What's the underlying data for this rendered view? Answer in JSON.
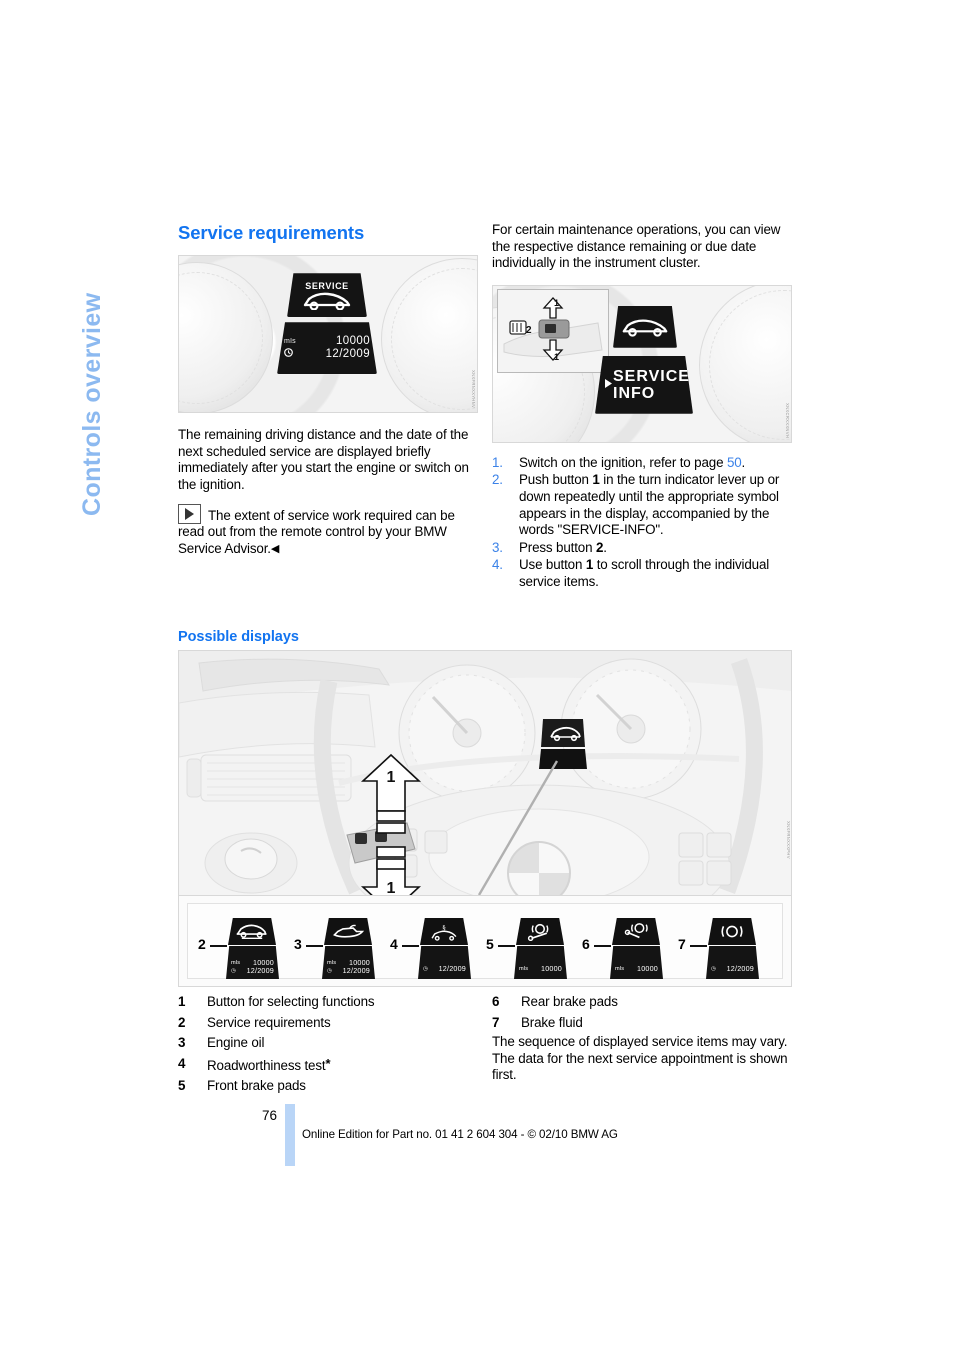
{
  "sidetab": {
    "label": "Controls overview"
  },
  "left": {
    "heading": "Service requirements",
    "figure1": {
      "name": "instrument-cluster-service-display",
      "service_label": "SERVICE",
      "unit": "mls",
      "distance": "10000",
      "date": "12/2009",
      "code": "XNXFRNXXYHNV"
    },
    "paragraph": "The remaining driving distance and the date of the next scheduled service are displayed briefly immediately after you start the engine or switch on the ignition.",
    "note": {
      "icon": "note-triangle-icon",
      "text": "The extent of service work required can be read out from the remote control by your BMW Service Advisor.",
      "endmark": "◀"
    },
    "subheading": "Possible displays"
  },
  "right": {
    "intro": "For certain maintenance operations, you can view the respective distance remaining or due date individually in the instrument cluster.",
    "figure2": {
      "name": "instrument-cluster-service-info-display",
      "inset_labels": [
        "1",
        "2"
      ],
      "display_text_line1": "SERVICE-",
      "display_text_line2": "INFO",
      "code": "XNXCRXXXNVH"
    },
    "steps": [
      {
        "num": "1.",
        "parts": [
          {
            "t": "Switch on the ignition, refer to page "
          },
          {
            "t": "50",
            "style": "link"
          },
          {
            "t": "."
          }
        ]
      },
      {
        "num": "2.",
        "parts": [
          {
            "t": "Push button "
          },
          {
            "t": "1",
            "style": "bold"
          },
          {
            "t": " in the turn indicator lever up or down repeatedly until the appropriate symbol appears in the display, accompanied by the words \"SERVICE-INFO\"."
          }
        ]
      },
      {
        "num": "3.",
        "parts": [
          {
            "t": "Press button "
          },
          {
            "t": "2",
            "style": "bold"
          },
          {
            "t": "."
          }
        ]
      },
      {
        "num": "4.",
        "parts": [
          {
            "t": "Use button "
          },
          {
            "t": "1",
            "style": "bold"
          },
          {
            "t": " to scroll through the individual service items."
          }
        ]
      }
    ]
  },
  "bigfigure": {
    "name": "steering-wheel-and-cluster-photo",
    "code": "XNXFRNXXXPHV",
    "arrow_labels": {
      "up": "1",
      "down": "1"
    },
    "icons": [
      {
        "num": "2",
        "symbol": "service-car-icon",
        "unit": "mls",
        "distance": "10000",
        "date": "12/2009"
      },
      {
        "num": "3",
        "symbol": "engine-oil-can-icon",
        "unit": "mls",
        "distance": "10000",
        "date": "12/2009"
      },
      {
        "num": "4",
        "symbol": "roadworthiness-car-icon",
        "unit": "",
        "distance": "",
        "date": "12/2009"
      },
      {
        "num": "5",
        "symbol": "front-brake-pads-icon",
        "unit": "mls",
        "distance": "10000",
        "date": ""
      },
      {
        "num": "6",
        "symbol": "rear-brake-pads-icon",
        "unit": "mls",
        "distance": "10000",
        "date": ""
      },
      {
        "num": "7",
        "symbol": "brake-fluid-icon",
        "unit": "",
        "distance": "",
        "date": "12/2009"
      }
    ]
  },
  "legend_left": [
    {
      "num": "1",
      "label": "Button for selecting functions",
      "star": ""
    },
    {
      "num": "2",
      "label": "Service requirements",
      "star": ""
    },
    {
      "num": "3",
      "label": "Engine oil",
      "star": ""
    },
    {
      "num": "4",
      "label": "Roadworthiness test",
      "star": "*"
    },
    {
      "num": "5",
      "label": "Front brake pads",
      "star": ""
    }
  ],
  "legend_right": [
    {
      "num": "6",
      "label": "Rear brake pads",
      "star": ""
    },
    {
      "num": "7",
      "label": "Brake fluid",
      "star": ""
    }
  ],
  "closing": "The sequence of displayed service items may vary. The data for the next service appointment is shown first.",
  "footer": {
    "page_number": "76",
    "edition_line": "Online Edition for Part no. 01 41 2 604 304 - © 02/10 BMW AG"
  },
  "colors": {
    "heading_blue": "#1274f0",
    "sidetab_blue": "#8cb9f0",
    "list_number_blue": "#3b82e8",
    "page_bar_blue": "#b9d5f7"
  }
}
